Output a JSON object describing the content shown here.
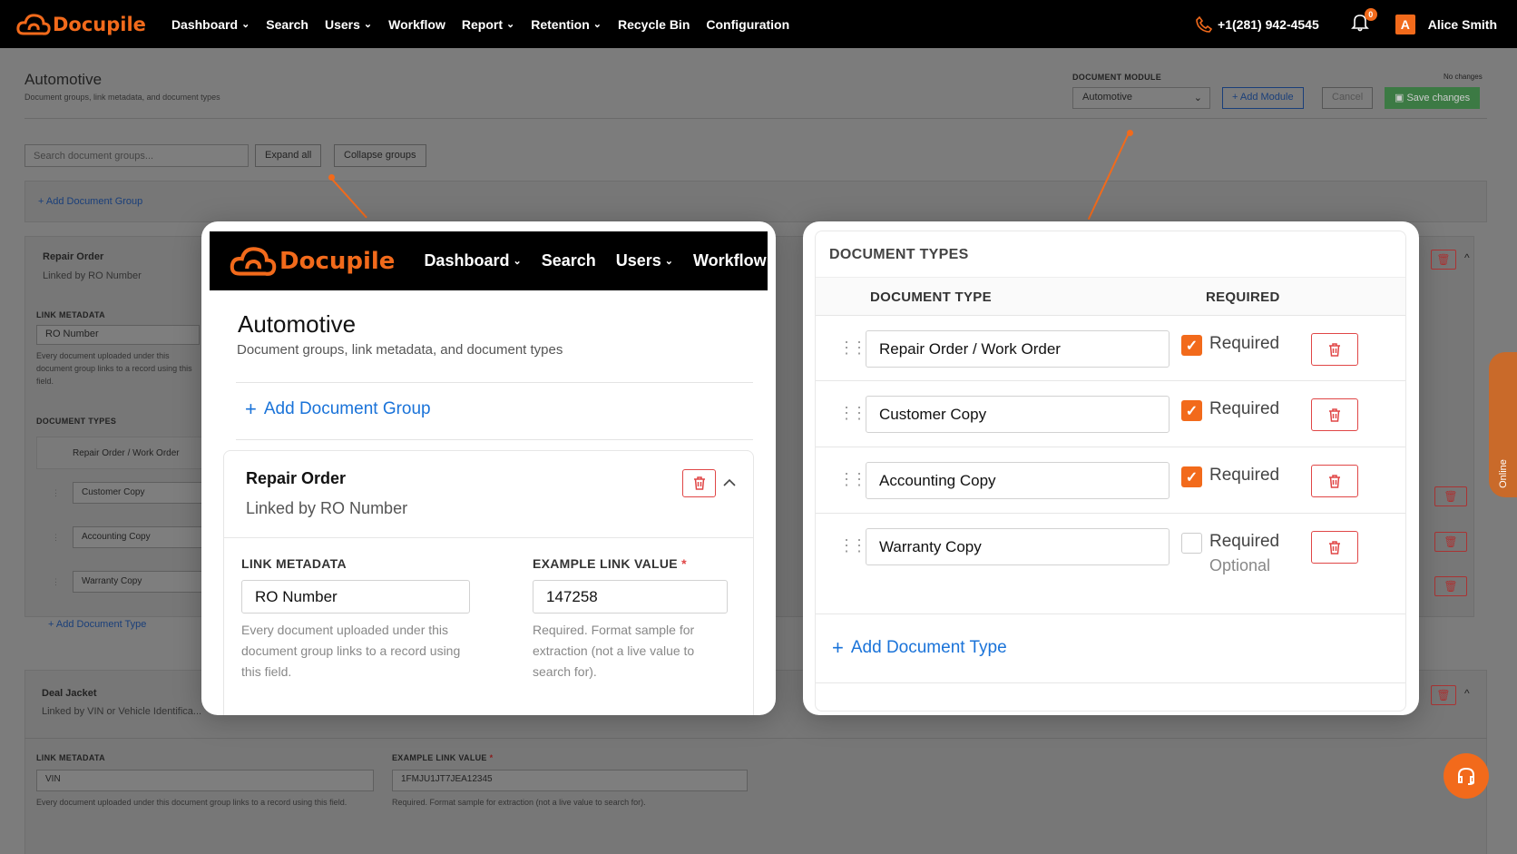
{
  "nav": {
    "brand": "Docupile",
    "items": [
      {
        "label": "Dashboard",
        "chevron": true
      },
      {
        "label": "Search",
        "chevron": false
      },
      {
        "label": "Users",
        "chevron": true
      },
      {
        "label": "Workflow",
        "chevron": false
      },
      {
        "label": "Report",
        "chevron": true
      },
      {
        "label": "Retention",
        "chevron": true
      },
      {
        "label": "Recycle Bin",
        "chevron": false
      },
      {
        "label": "Configuration",
        "chevron": false
      }
    ],
    "phone": "+1(281) 942-4545",
    "notification_count": "0",
    "avatar_initial": "A",
    "user_name": "Alice Smith"
  },
  "page": {
    "title": "Automotive",
    "subtitle": "Document groups, link metadata, and document types",
    "module_label": "DOCUMENT MODULE",
    "module_value": "Automotive",
    "no_changes": "No changes",
    "add_module": "Add Module",
    "cancel": "Cancel",
    "save": "Save changes",
    "search_placeholder": "Search document groups...",
    "expand_all": "Expand all",
    "collapse_all": "Collapse groups",
    "add_group": "Add Document Group"
  },
  "groups": [
    {
      "name": "Repair Order",
      "linked": "Linked by RO Number",
      "link_metadata_label": "LINK METADATA",
      "link_metadata_value": "RO Number",
      "link_help": "Every document uploaded under this document group links to a record using this field.",
      "example_label": "EXAMPLE LINK VALUE",
      "example_value": "147258",
      "example_help": "Required. Format sample for extraction (not a live value to search for).",
      "doc_types_label": "DOCUMENT TYPES",
      "add_doc_type": "Add Document Type"
    },
    {
      "name": "Deal Jacket",
      "linked": "Linked by VIN or Vehicle Identifica...",
      "link_metadata_label": "LINK METADATA",
      "link_metadata_value": "VIN",
      "link_help": "Every document uploaded under this document group links to a record using this field.",
      "example_label": "EXAMPLE LINK VALUE",
      "example_value": "1FMJU1JT7JEA12345",
      "example_help": "Required. Format sample for extraction (not a live value to search for)."
    }
  ],
  "doc_types_panel": {
    "title": "DOCUMENT TYPES",
    "col_type": "DOCUMENT TYPE",
    "col_required": "REQUIRED",
    "required_label": "Required",
    "optional_label": "Optional",
    "rows": [
      {
        "name": "Repair Order / Work Order",
        "required": true
      },
      {
        "name": "Customer Copy",
        "required": true
      },
      {
        "name": "Accounting Copy",
        "required": true
      },
      {
        "name": "Warranty Copy",
        "required": false
      }
    ],
    "add_doc_type": "Add Document Type"
  },
  "online_label": "Online",
  "colors": {
    "brand": "#f26a1b",
    "link": "#1a73d9",
    "danger": "#e04646"
  }
}
